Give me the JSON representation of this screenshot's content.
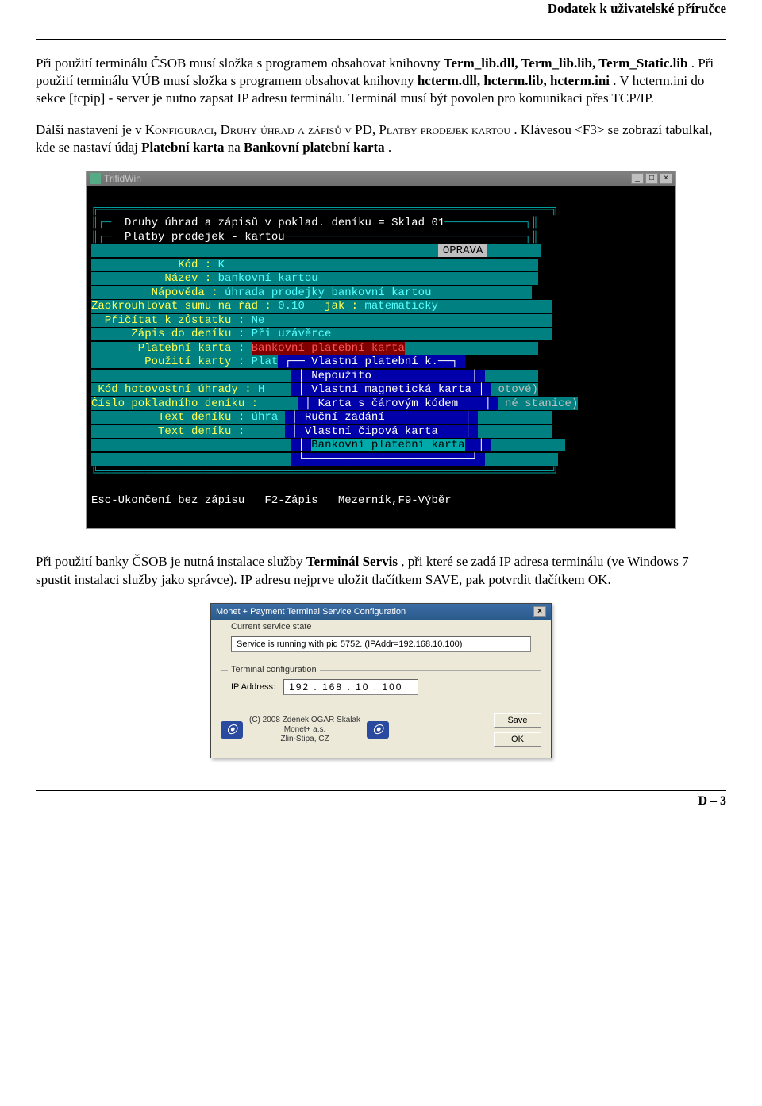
{
  "header": {
    "title": "Dodatek k uživatelské příručce"
  },
  "para1": {
    "pre": "Při použití terminálu ČSOB musí složka s programem obsahovat knihovny ",
    "bold1": "Term_lib.dll, Term_lib.lib, Term_Static.lib",
    "mid1": ". Při použití terminálu VÚB musí složka s programem obsahovat knihovny ",
    "bold2": "hcterm.dll, hcterm.lib, hcterm.ini",
    "mid2": ". V hcterm.ini do sekce [tcpip] - server je nutno zapsat IP adresu terminálu. Terminál musí být povolen pro komunikaci přes TCP/IP."
  },
  "para2": {
    "pre": "Dálší nastavení je v ",
    "sc1": "Konfiguraci, Druhy úhrad a zápisů v PD, Platby prodejek kartou",
    "post": ". Klávesou <F3> se zobrazí tabulkal, kde se nastaví údaj ",
    "bold1": "Platební karta",
    "mid": " na ",
    "bold2": "Bankovní platební karta",
    "end": "."
  },
  "trifid": {
    "title": "TrifidWin",
    "headerline": "  Druhy úhrad a zápisů v poklad. deníku = Sklad 01",
    "subheader": "  Platby prodejek - kartou",
    "oprava": "OPRAVA",
    "labels": {
      "kod": "             Kód : ",
      "nazev": "           Název : ",
      "napoveda": "         Nápověda : ",
      "zaokr": "Zaokrouhlovat sumu na řád : ",
      "jak": "   jak : ",
      "pricitat": "  Přičítat k zůstatku : ",
      "zapis": "      Zápis do deníku : ",
      "pkarta": "       Platební karta : ",
      "pouziti": "        Použití karty : ",
      "kodhot": " Kód hotovostní úhrady : ",
      "cislo": "Číslo pokladního deníku : ",
      "textd": "          Text deníku : ",
      "textd2": "          Text deníku : "
    },
    "values": {
      "kod": "K",
      "nazev": "bankovní kartou",
      "napoveda": "úhrada prodejky bankovní kartou",
      "zaokr": "0.10",
      "jak": "matematicky",
      "pricitat": "Ne",
      "zapis": "Při uzávěrce",
      "pkarta": "Bankovní platební karta",
      "pouziti": "Plat",
      "kodhot": "H",
      "cislo": "",
      "textd": "úhra",
      "textd2": ""
    },
    "popup_title": "── Vlastní platební k.──",
    "popup_items": [
      "Nepoužito",
      "Vlastní magnetická karta",
      "Karta s čárovým kódem",
      "Ruční zadání",
      "Vlastní čipová karta",
      "Bankovní platební karta"
    ],
    "side_hints": {
      "otove": "otové)",
      "stanice": "né stanice)"
    },
    "status": "Esc-Ukončení bez zápisu   F2-Zápis   Mezerník,F9-Výběr"
  },
  "para3": {
    "pre": "Při použití banky ČSOB je nutná instalace služby ",
    "bold1": "Terminál Servis",
    "post": ", při které se zadá IP adresa terminálu (ve Windows 7 spustit instalaci služby jako správce). IP adresu nejprve uložit tlačítkem SAVE, pak potvrdit tlačítkem OK."
  },
  "monet": {
    "title": "Monet + Payment Terminal Service Configuration",
    "fs1_legend": "Current service state",
    "fs1_value": "Service is running with pid 5752. (IPAddr=192.168.10.100)",
    "fs2_legend": "Terminal configuration",
    "ip_label": "IP Address:",
    "ip_value": "192 . 168 .  10 . 100",
    "copyright1": "(C) 2008 Zdenek OGAR Skalak",
    "copyright2": "Monet+ a.s.",
    "copyright3": "Zlin-Stipa, CZ",
    "logo_glyph": "⦿",
    "save": "Save",
    "ok": "OK"
  },
  "footer": {
    "page": "D – 3"
  }
}
